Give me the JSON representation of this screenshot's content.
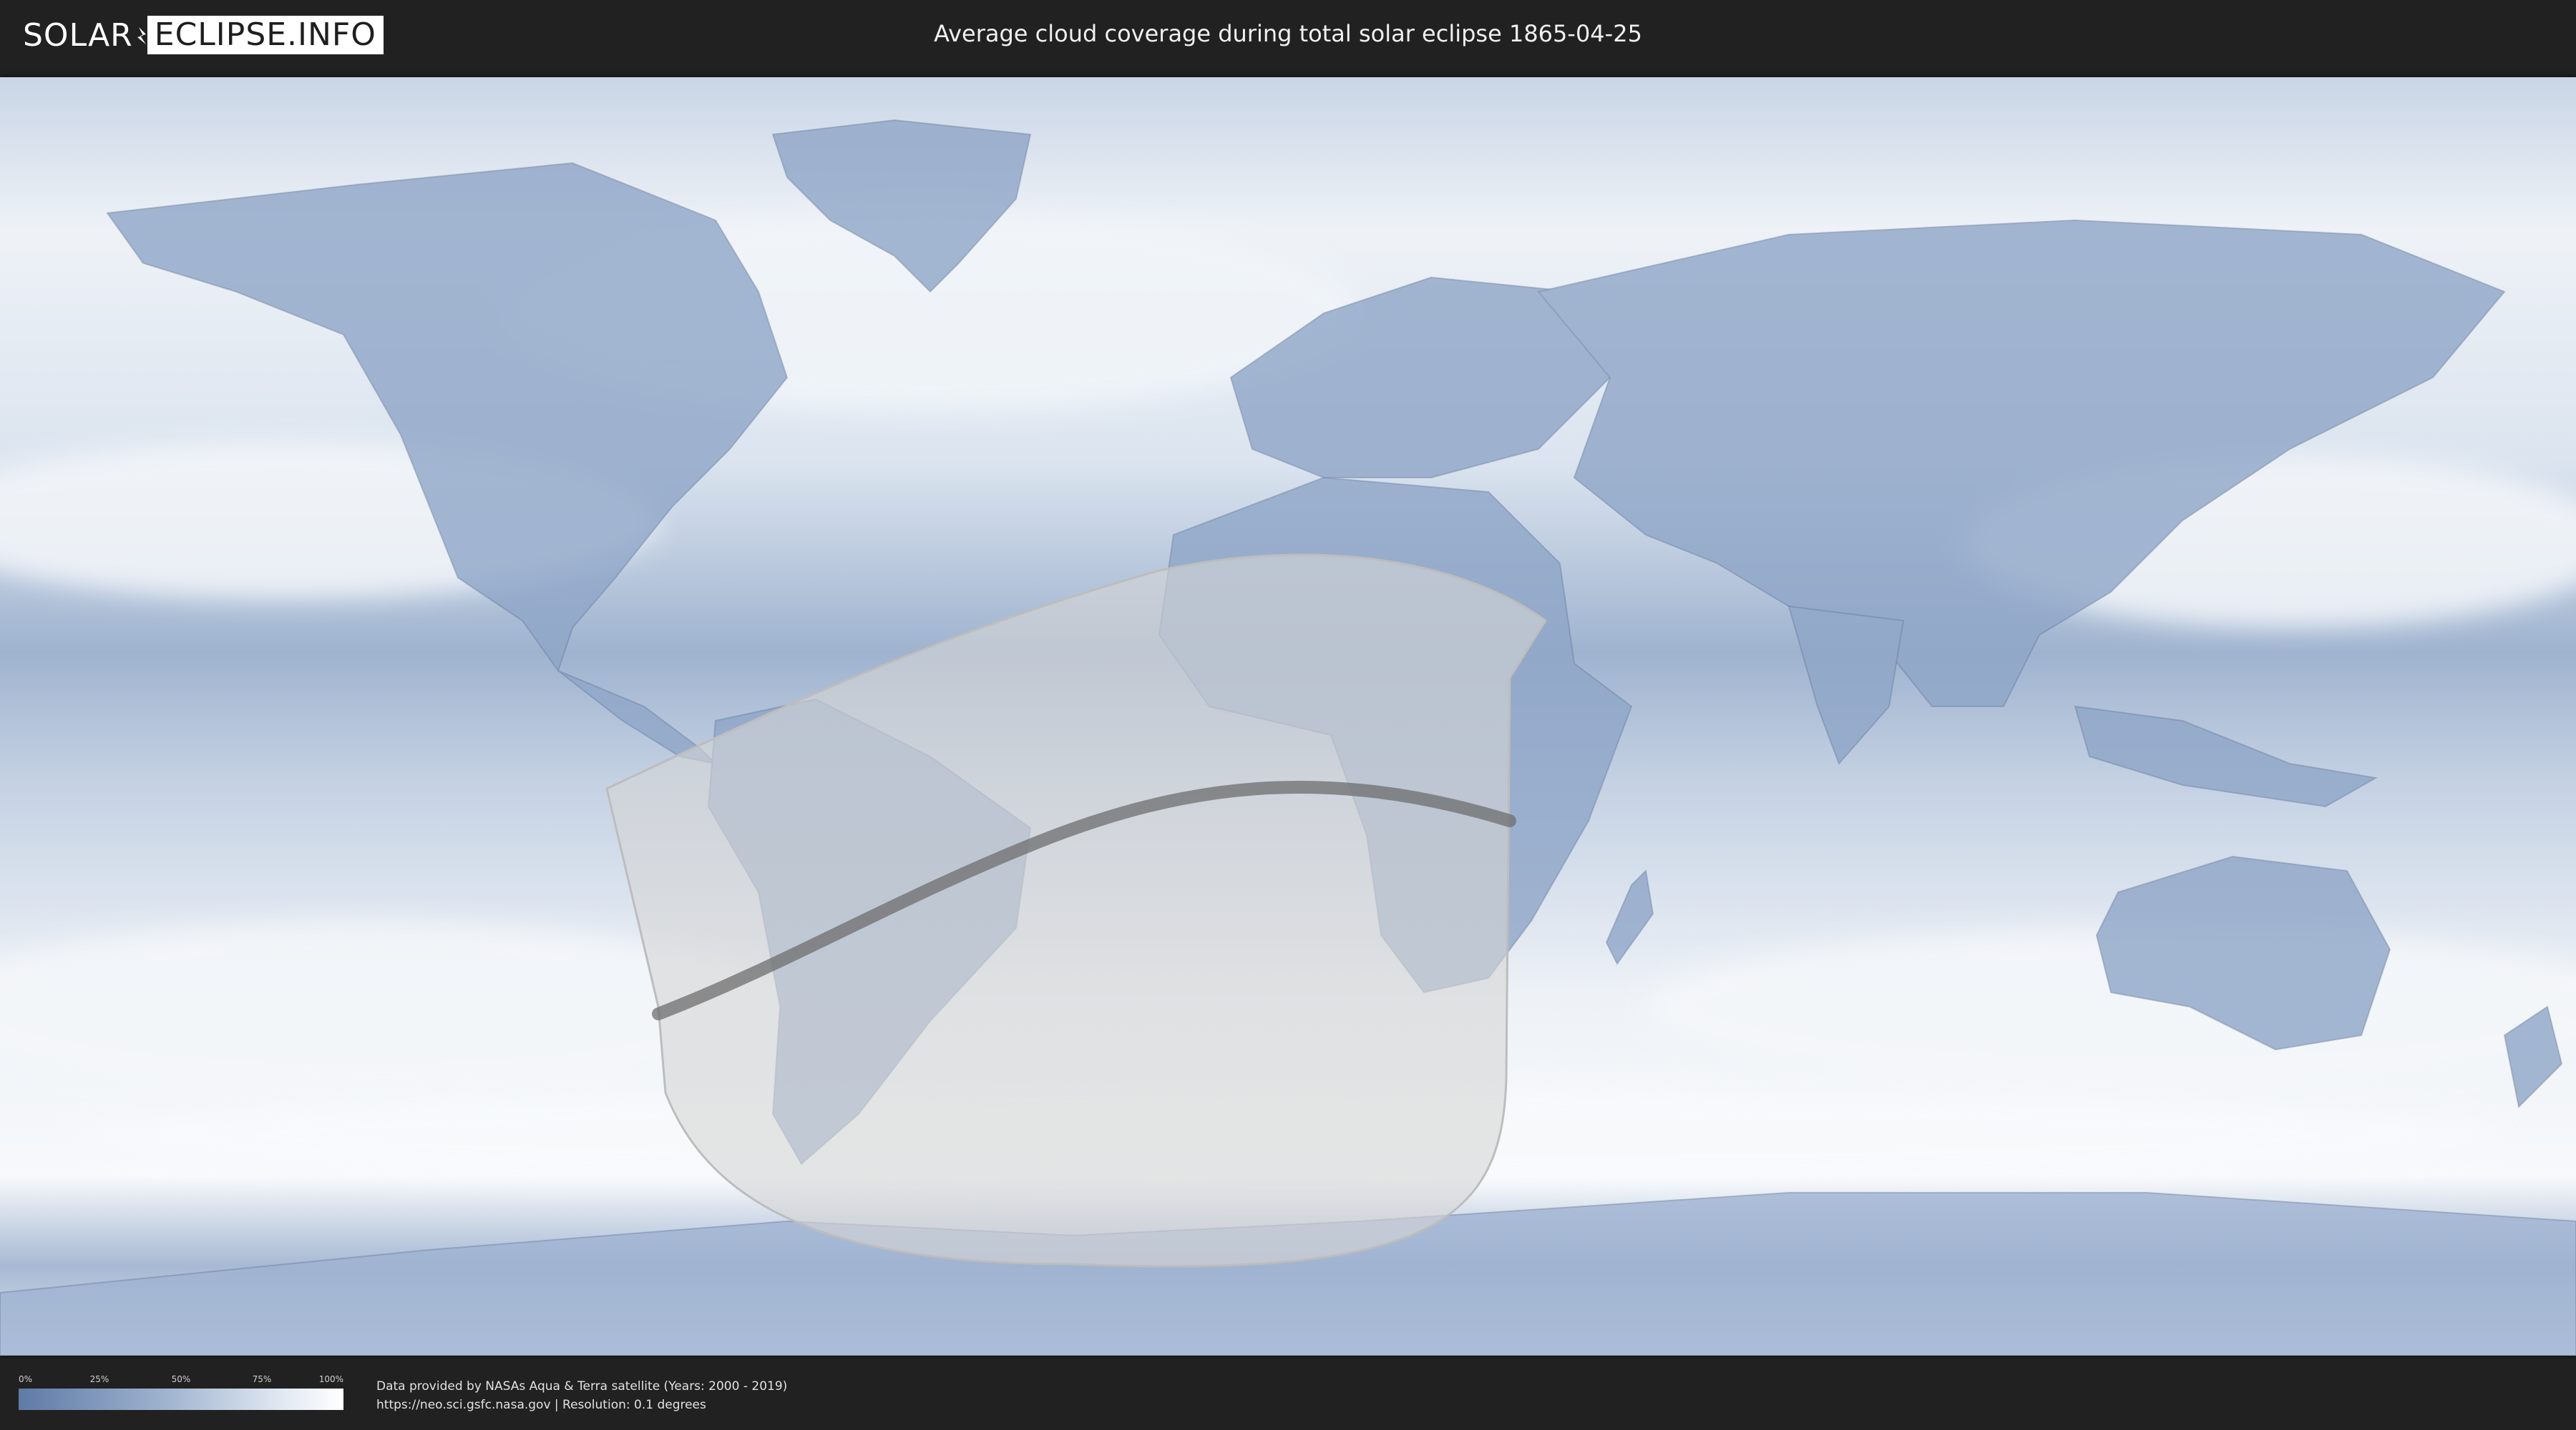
{
  "header": {
    "logo_left": "SOLAR",
    "logo_right": "ECLIPSE.INFO",
    "title": "Average cloud coverage during total solar eclipse 1865-04-25"
  },
  "map": {
    "description_icon": "world-cloud-map",
    "colors": {
      "ocean_clear": "#6f8cb6",
      "cloud": "#eef2f7",
      "land_shade": "#7c95bd",
      "visibility_zone": "#d8d8d8",
      "totality_path": "#707070"
    }
  },
  "legend": {
    "ticks": [
      "0%",
      "25%",
      "50%",
      "75%",
      "100%"
    ]
  },
  "credits": {
    "line1": "Data provided by NASAs Aqua & Terra satellite (Years: 2000 - 2019)",
    "line2": "https://neo.sci.gsfc.nasa.gov | Resolution: 0.1 degrees"
  }
}
